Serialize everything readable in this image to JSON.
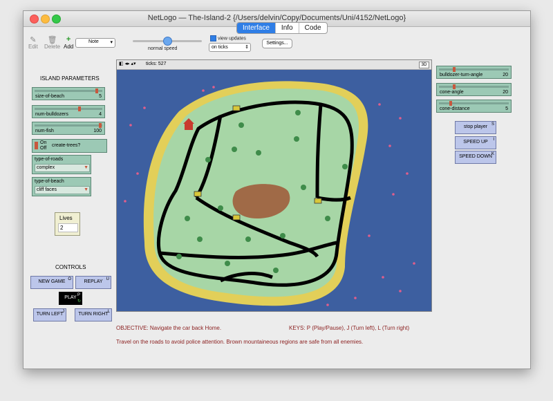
{
  "window": {
    "title": "NetLogo — The-Island-2 {/Users/delvin/Copy/Documents/Uni/4152/NetLogo}"
  },
  "tabs": [
    {
      "label": "Interface",
      "active": true
    },
    {
      "label": "Info"
    },
    {
      "label": "Code"
    }
  ],
  "toolbar": {
    "edit": "Edit",
    "delete": "Delete",
    "add": "Add",
    "widget_select": "Note",
    "speed_label": "normal speed",
    "view_updates": "view updates",
    "update_mode": "on ticks",
    "settings": "Settings..."
  },
  "left": {
    "header": "ISLAND PARAMETERS",
    "sliders": [
      {
        "label": "size-of-beach",
        "value": "5",
        "level": 0.9
      },
      {
        "label": "num-bulldozers",
        "value": "4",
        "level": 0.65
      },
      {
        "label": "num-fish",
        "value": "100",
        "level": 0.95
      }
    ],
    "switch": {
      "on": "On",
      "off": "Off",
      "label": "create-trees?"
    },
    "choosers": [
      {
        "label": "type-of-roads",
        "value": "complex"
      },
      {
        "label": "type-of-beach",
        "value": "cliff faces"
      }
    ],
    "monitor": {
      "label": "Lives",
      "value": "2"
    },
    "controls_header": "CONTROLS",
    "buttons": {
      "new_game": "NEW GAME",
      "new_game_key": "O",
      "replay": "REPLAY",
      "replay_key": "U",
      "play": "PLAY",
      "play_key": "P",
      "turn_left": "TURN LEFT",
      "turn_left_key": "J",
      "turn_right": "TURN RIGHT",
      "turn_right_key": "L"
    }
  },
  "view": {
    "ticks": "ticks: 527",
    "mode_3d": "3D"
  },
  "right": {
    "sliders": [
      {
        "label": "bulldozer-turn-angle",
        "value": "20",
        "level": 0.2
      },
      {
        "label": "cone-angle",
        "value": "20",
        "level": 0.2
      },
      {
        "label": "cone-distance",
        "value": "5",
        "level": 0.15
      }
    ],
    "buttons": {
      "stop_player": "stop player",
      "stop_key": "S",
      "speed_up": "SPEED UP",
      "speed_up_key": "I",
      "speed_down": "SPEED DOWN",
      "speed_down_key": "K"
    }
  },
  "notes": {
    "objective": "OBJECTIVE: Navigate the car back Home.",
    "keys": "KEYS: P (Play/Pause), J (Turn left), L (Turn right)",
    "hint": "Travel on the roads to avoid police attention. Brown mountaineous regions are safe from all enemies."
  },
  "colors": {
    "sea": "#3d5fa0",
    "beach": "#e2cf59",
    "grass": "#a7d6a6",
    "road": "#000000",
    "mountain": "#a06a47",
    "tree": "#3f8c4a",
    "house": "#c83a2e"
  }
}
